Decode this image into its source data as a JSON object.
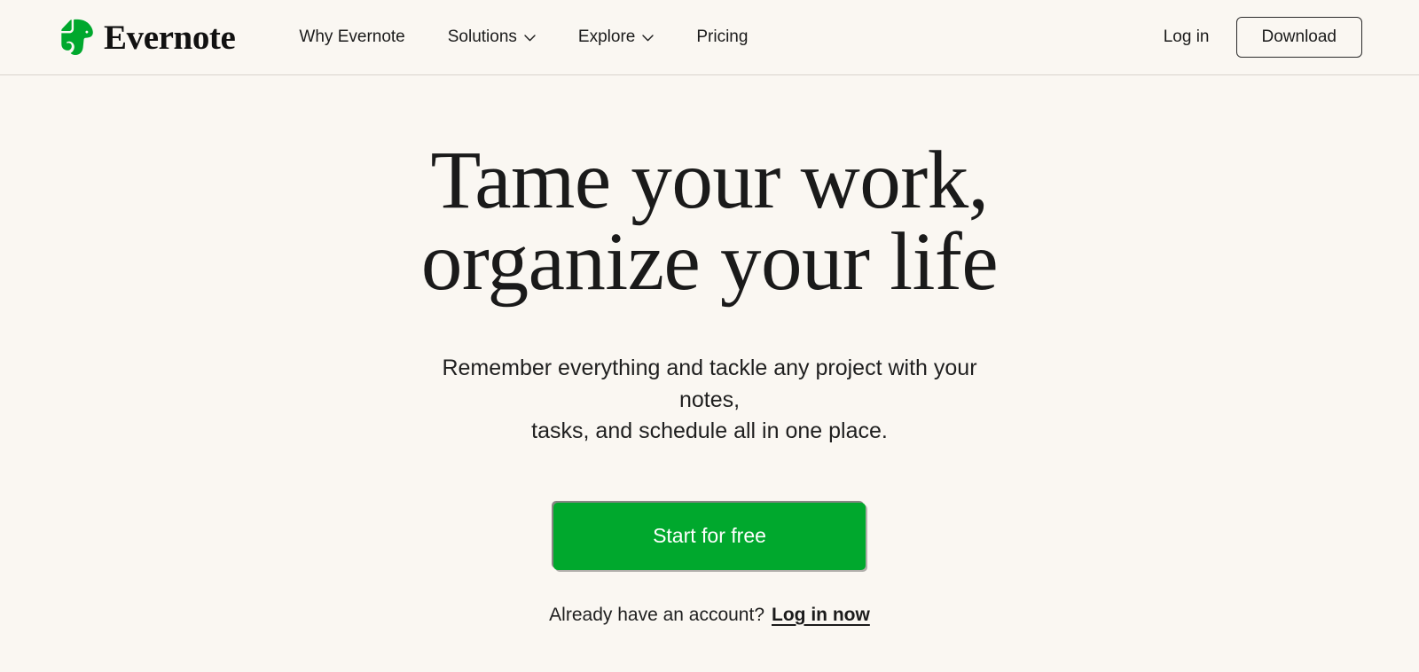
{
  "header": {
    "brand": {
      "name": "Evernote",
      "logo_icon": "evernote-elephant-icon",
      "logo_color": "#00a82d"
    },
    "nav": [
      {
        "label": "Why Evernote",
        "has_dropdown": false
      },
      {
        "label": "Solutions",
        "has_dropdown": true,
        "icon": "chevron-down-icon"
      },
      {
        "label": "Explore",
        "has_dropdown": true,
        "icon": "chevron-down-icon"
      },
      {
        "label": "Pricing",
        "has_dropdown": false
      }
    ],
    "login_label": "Log in",
    "download_label": "Download"
  },
  "hero": {
    "headline_line1": "Tame your work,",
    "headline_line2": "organize your life",
    "subhead_line1": "Remember everything and tackle any project with your notes,",
    "subhead_line2": "tasks, and schedule all in one place.",
    "cta_label": "Start for free",
    "cta_color": "#00a82d",
    "account_prompt": "Already have an account?",
    "account_link_label": "Log in now"
  },
  "theme": {
    "background": "#faf7f2",
    "text": "#1b1b1b",
    "accent": "#00a82d",
    "border": "#d8d4cd"
  }
}
